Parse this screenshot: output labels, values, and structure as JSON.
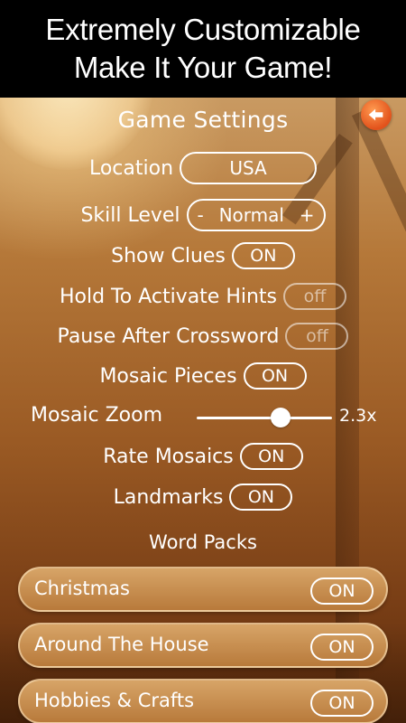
{
  "banner": {
    "line1": "Extremely Customizable",
    "line2": "Make It Your Game!"
  },
  "settings": {
    "title": "Game Settings",
    "location": {
      "label": "Location",
      "value": "USA"
    },
    "skill": {
      "label": "Skill Level",
      "minus": "-",
      "value": "Normal",
      "plus": "+"
    },
    "show_clues": {
      "label": "Show Clues",
      "state": "ON"
    },
    "hold_hints": {
      "label": "Hold To Activate Hints",
      "state": "off"
    },
    "pause_after": {
      "label": "Pause After Crossword",
      "state": "off"
    },
    "mosaic_pieces": {
      "label": "Mosaic Pieces",
      "state": "ON"
    },
    "mosaic_zoom": {
      "label": "Mosaic Zoom",
      "value": "2.3x",
      "slider_fraction": 0.62
    },
    "rate_mosaics": {
      "label": "Rate Mosaics",
      "state": "ON"
    },
    "landmarks": {
      "label": "Landmarks",
      "state": "ON"
    }
  },
  "word_packs": {
    "title": "Word Packs",
    "items": [
      {
        "name": "Christmas",
        "state": "ON"
      },
      {
        "name": "Around The House",
        "state": "ON"
      },
      {
        "name": "Hobbies & Crafts",
        "state": "ON"
      }
    ]
  },
  "icons": {
    "back": "back-arrow-icon"
  },
  "colors": {
    "back_button": "#e2521b",
    "text": "#ffffff"
  }
}
